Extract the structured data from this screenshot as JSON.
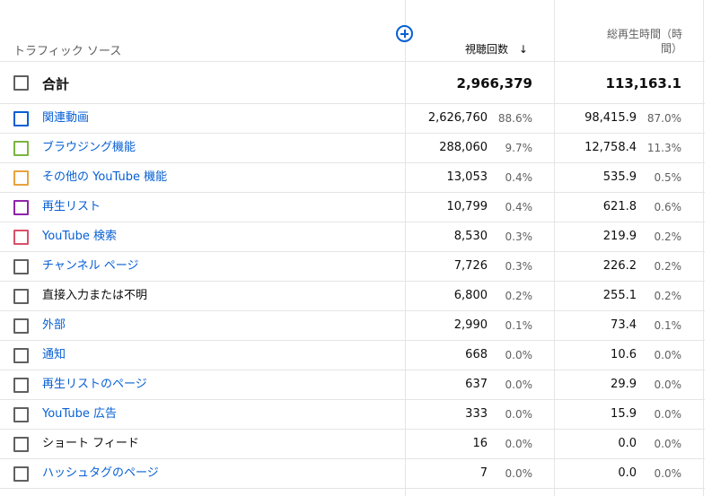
{
  "header": {
    "source_label": "トラフィック ソース",
    "views_label": "視聴回数",
    "sort_arrow": "↓",
    "watch_time_line1": "総再生時間（時",
    "watch_time_line2": "間）",
    "add_metric_icon": "plus-circle-icon"
  },
  "total": {
    "label": "合計",
    "views": "2,966,379",
    "watch_time": "113,163.1"
  },
  "rows": [
    {
      "name": "関連動画",
      "views": "2,626,760",
      "views_pct": "88.6%",
      "watch": "98,415.9",
      "watch_pct": "87.0%",
      "color": "#065fd4",
      "link": true
    },
    {
      "name": "ブラウジング機能",
      "views": "288,060",
      "views_pct": "9.7%",
      "watch": "12,758.4",
      "watch_pct": "11.3%",
      "color": "#7cb342",
      "link": true
    },
    {
      "name": "その他の YouTube 機能",
      "views": "13,053",
      "views_pct": "0.4%",
      "watch": "535.9",
      "watch_pct": "0.5%",
      "color": "#e8a33d",
      "link": true
    },
    {
      "name": "再生リスト",
      "views": "10,799",
      "views_pct": "0.4%",
      "watch": "621.8",
      "watch_pct": "0.6%",
      "color": "#8e24aa",
      "link": true
    },
    {
      "name": "YouTube 検索",
      "views": "8,530",
      "views_pct": "0.3%",
      "watch": "219.9",
      "watch_pct": "0.2%",
      "color": "#d9506a",
      "link": true
    },
    {
      "name": "チャンネル ページ",
      "views": "7,726",
      "views_pct": "0.3%",
      "watch": "226.2",
      "watch_pct": "0.2%",
      "color": "#606060",
      "link": true
    },
    {
      "name": "直接入力または不明",
      "views": "6,800",
      "views_pct": "0.2%",
      "watch": "255.1",
      "watch_pct": "0.2%",
      "color": "#606060",
      "link": false
    },
    {
      "name": "外部",
      "views": "2,990",
      "views_pct": "0.1%",
      "watch": "73.4",
      "watch_pct": "0.1%",
      "color": "#606060",
      "link": true
    },
    {
      "name": "通知",
      "views": "668",
      "views_pct": "0.0%",
      "watch": "10.6",
      "watch_pct": "0.0%",
      "color": "#606060",
      "link": true
    },
    {
      "name": "再生リストのページ",
      "views": "637",
      "views_pct": "0.0%",
      "watch": "29.9",
      "watch_pct": "0.0%",
      "color": "#606060",
      "link": true
    },
    {
      "name": "YouTube 広告",
      "views": "333",
      "views_pct": "0.0%",
      "watch": "15.9",
      "watch_pct": "0.0%",
      "color": "#606060",
      "link": true
    },
    {
      "name": "ショート フィード",
      "views": "16",
      "views_pct": "0.0%",
      "watch": "0.0",
      "watch_pct": "0.0%",
      "color": "#606060",
      "link": false
    },
    {
      "name": "ハッシュタグのページ",
      "views": "7",
      "views_pct": "0.0%",
      "watch": "0.0",
      "watch_pct": "0.0%",
      "color": "#606060",
      "link": true
    }
  ]
}
